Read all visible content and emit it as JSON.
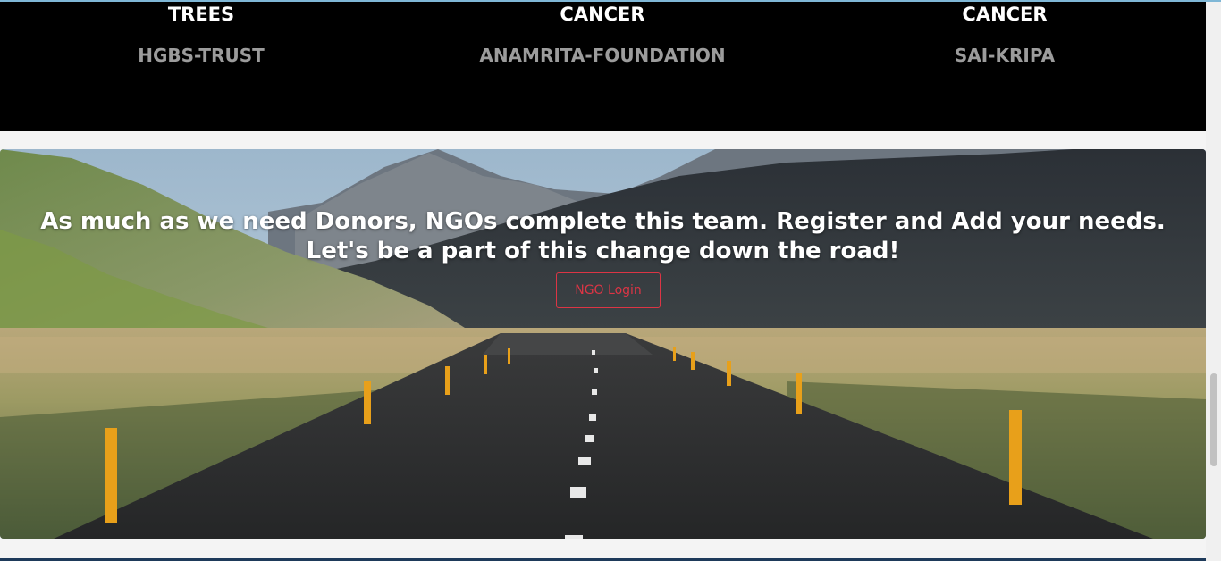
{
  "ngos": [
    {
      "cause": "TREES",
      "name": "HGBS-TRUST"
    },
    {
      "cause": "CANCER",
      "name": "ANAMRITA-FOUNDATION"
    },
    {
      "cause": "CANCER",
      "name": "SAI-KRIPA"
    }
  ],
  "hero": {
    "message": "As much as we need Donors, NGOs complete this team. Register and Add your needs. Let's be a part of this change down the road!",
    "button_label": "NGO Login",
    "button_color": "#dc3545"
  },
  "scrollbar": {
    "position_fraction": 0.87
  }
}
